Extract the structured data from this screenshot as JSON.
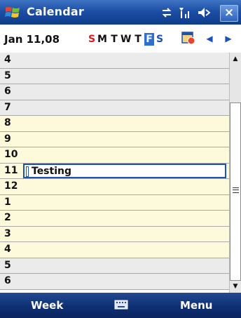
{
  "title_bar": {
    "app_title": "Calendar",
    "close_label": "×"
  },
  "date_bar": {
    "date": "Jan 11,08",
    "weekdays": [
      "S",
      "M",
      "T",
      "W",
      "T",
      "F",
      "S"
    ],
    "selected_index": 5
  },
  "hours": [
    {
      "label": "4",
      "kind": "off"
    },
    {
      "label": "5",
      "kind": "off"
    },
    {
      "label": "6",
      "kind": "off"
    },
    {
      "label": "7",
      "kind": "off"
    },
    {
      "label": "8",
      "kind": "work"
    },
    {
      "label": "9",
      "kind": "work"
    },
    {
      "label": "10",
      "kind": "work"
    },
    {
      "label": "11",
      "kind": "work"
    },
    {
      "label": "12",
      "kind": "work"
    },
    {
      "label": "1",
      "kind": "work"
    },
    {
      "label": "2",
      "kind": "work"
    },
    {
      "label": "3",
      "kind": "work"
    },
    {
      "label": "4",
      "kind": "work"
    },
    {
      "label": "5",
      "kind": "off"
    },
    {
      "label": "6",
      "kind": "off"
    }
  ],
  "appointment": {
    "title": "Testing",
    "hour_index": 7
  },
  "soft_keys": {
    "left": "Week",
    "right": "Menu"
  },
  "colors": {
    "title_bar": "#1d4fa6",
    "off_hours": "#ebebeb",
    "work_hours": "#fcfadb",
    "selected_day": "#2e6fd0",
    "sunday": "#d21e1e",
    "saturday": "#1c52b5"
  },
  "icons": [
    "windows-start-icon",
    "connectivity-icon",
    "signal-icon",
    "volume-icon",
    "close-icon",
    "date-picker-icon",
    "prev-arrow-icon",
    "next-arrow-icon",
    "keyboard-icon"
  ]
}
